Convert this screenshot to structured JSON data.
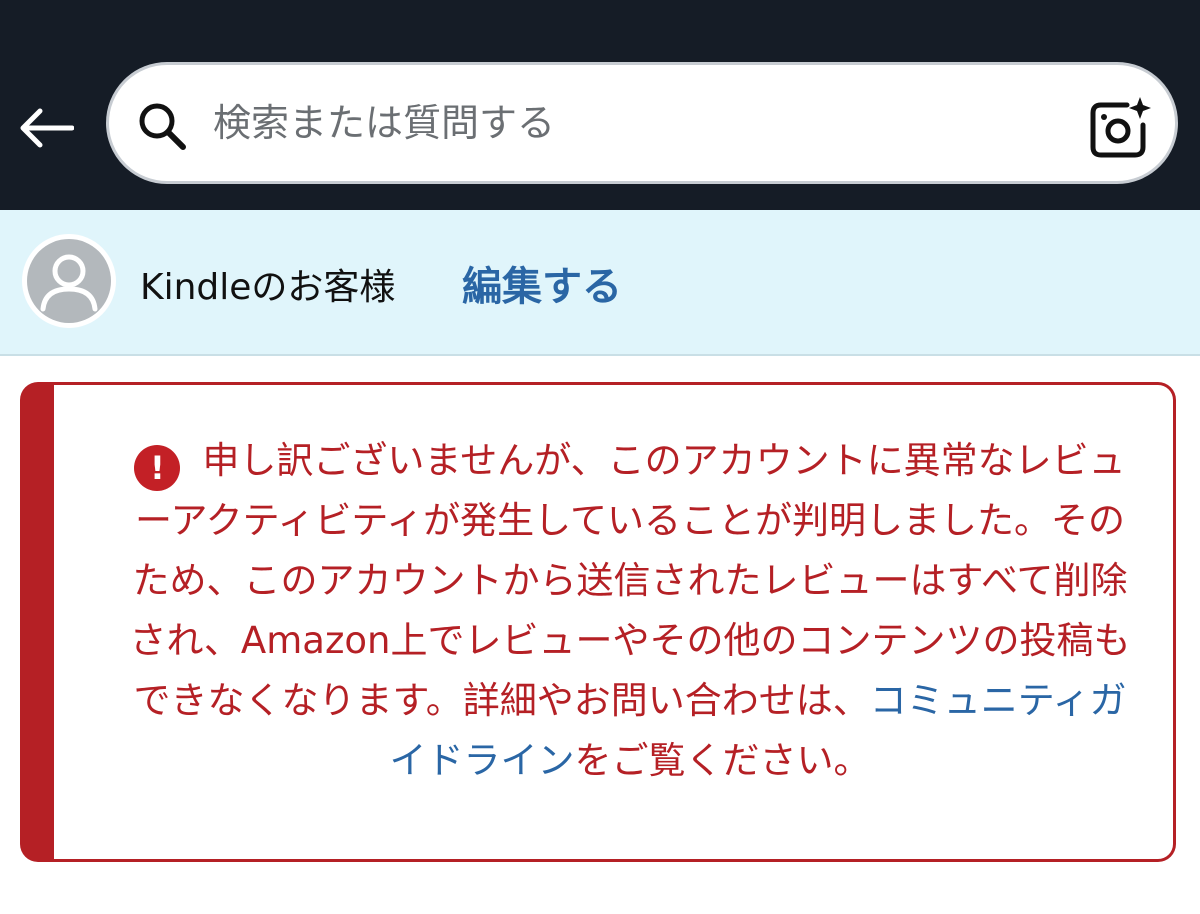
{
  "search": {
    "placeholder": "検索または質問する"
  },
  "customer": {
    "name": "Kindleのお客様",
    "edit_label": "編集する"
  },
  "alert": {
    "icon": "exclamation-icon",
    "message_before_link": "申し訳ございませんが、このアカウントに異常なレビューアクティビティが発生していることが判明しました。そのため、このアカウントから送信されたレビューはすべて削除され、Amazon上でレビューやその他のコンテンツの投稿もできなくなります。詳細やお問い合わせは、",
    "link_text": "コミュニティガイドライン",
    "message_after_link": "をご覧ください。",
    "icon_glyph": "!"
  },
  "colors": {
    "topbar": "#151c26",
    "customer_bar": "#e0f5fb",
    "alert_red": "#b52025",
    "link_blue": "#2a66a5"
  }
}
